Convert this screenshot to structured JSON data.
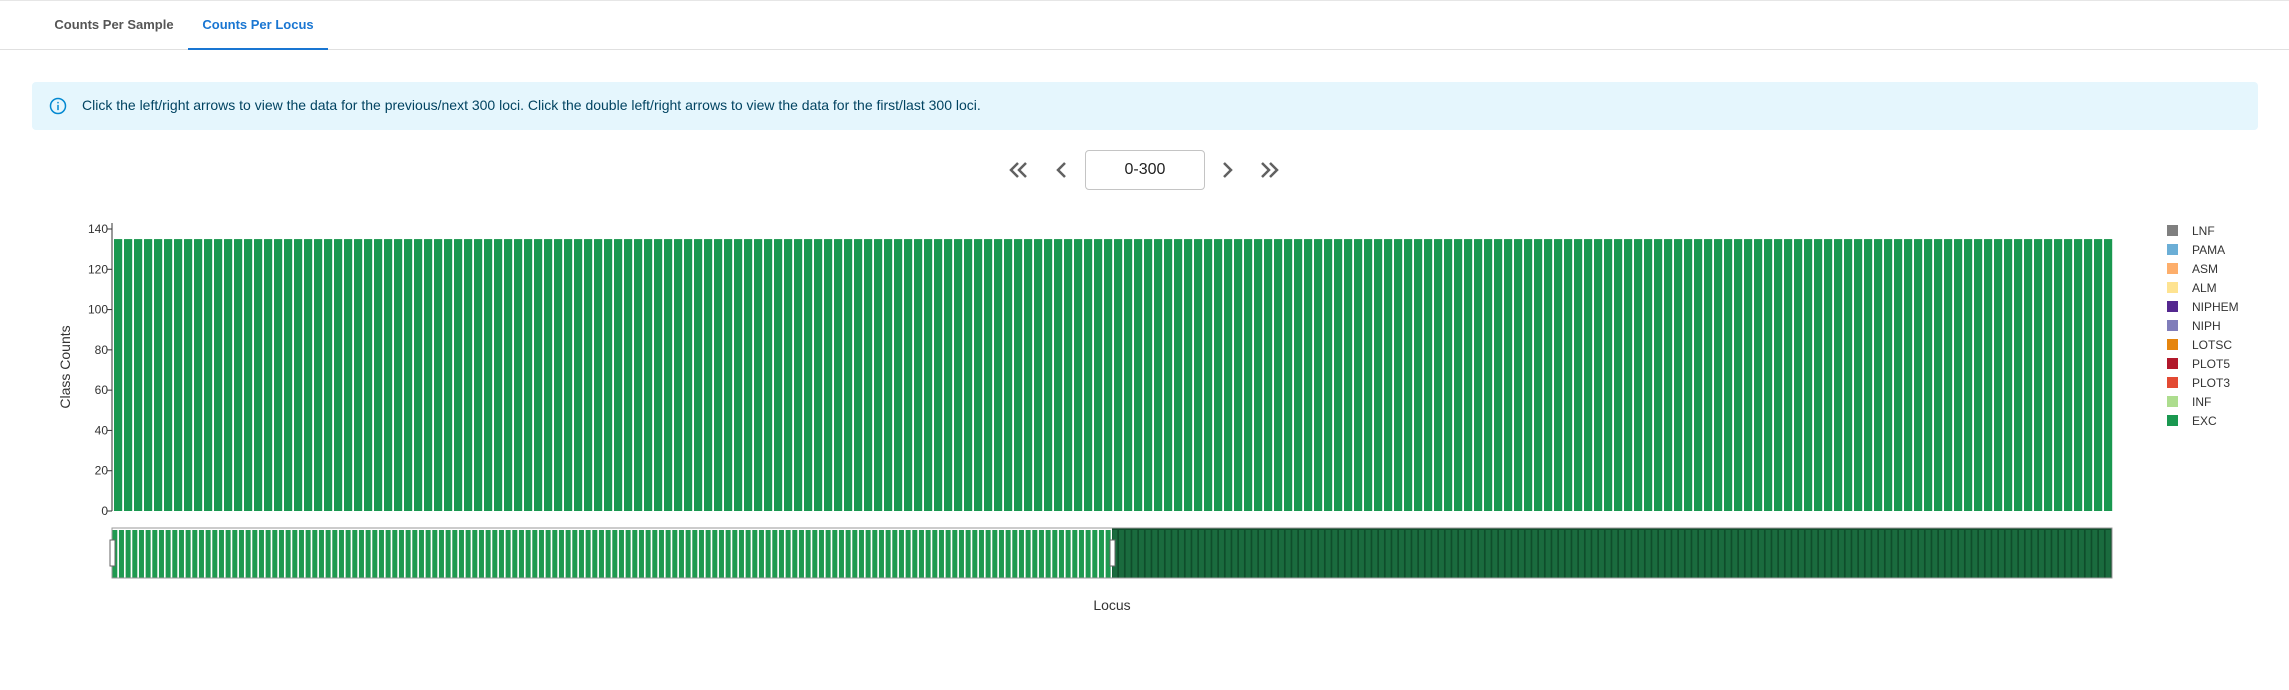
{
  "tabs": [
    {
      "label": "Counts Per Sample",
      "active": false
    },
    {
      "label": "Counts Per Locus",
      "active": true
    }
  ],
  "alert": {
    "message": "Click the left/right arrows to view the data for the previous/next 300 loci. Click the double left/right arrows to view the data for the first/last 300 loci.",
    "icon": "info-outline-icon"
  },
  "pager": {
    "range": "0-300",
    "first_icon": "double-chevron-left-icon",
    "prev_icon": "chevron-left-icon",
    "next_icon": "chevron-right-icon",
    "last_icon": "double-chevron-right-icon"
  },
  "chart_data": {
    "type": "bar",
    "stacked": true,
    "ylabel": "Class Counts",
    "xlabel": "Locus",
    "ylim": [
      0,
      140
    ],
    "yticks": [
      0,
      20,
      40,
      60,
      80,
      100,
      120,
      140
    ],
    "bar_count": 200,
    "bar_value": 135,
    "grid": false,
    "legend_position": "right",
    "brush": {
      "start_fraction": 0.0,
      "end_fraction": 0.5
    },
    "series": [
      {
        "name": "LNF",
        "color": "#7f7f7f"
      },
      {
        "name": "PAMA",
        "color": "#6baed6"
      },
      {
        "name": "ASM",
        "color": "#fdae6b"
      },
      {
        "name": "ALM",
        "color": "#fee391"
      },
      {
        "name": "NIPHEM",
        "color": "#54278f"
      },
      {
        "name": "NIPH",
        "color": "#807dba"
      },
      {
        "name": "LOTSC",
        "color": "#e6850e"
      },
      {
        "name": "PLOT5",
        "color": "#b2182b"
      },
      {
        "name": "PLOT3",
        "color": "#e34a33"
      },
      {
        "name": "INF",
        "color": "#addd8e"
      },
      {
        "name": "EXC",
        "color": "#1a9850"
      }
    ],
    "values_by_series": {
      "EXC": 135
    }
  }
}
